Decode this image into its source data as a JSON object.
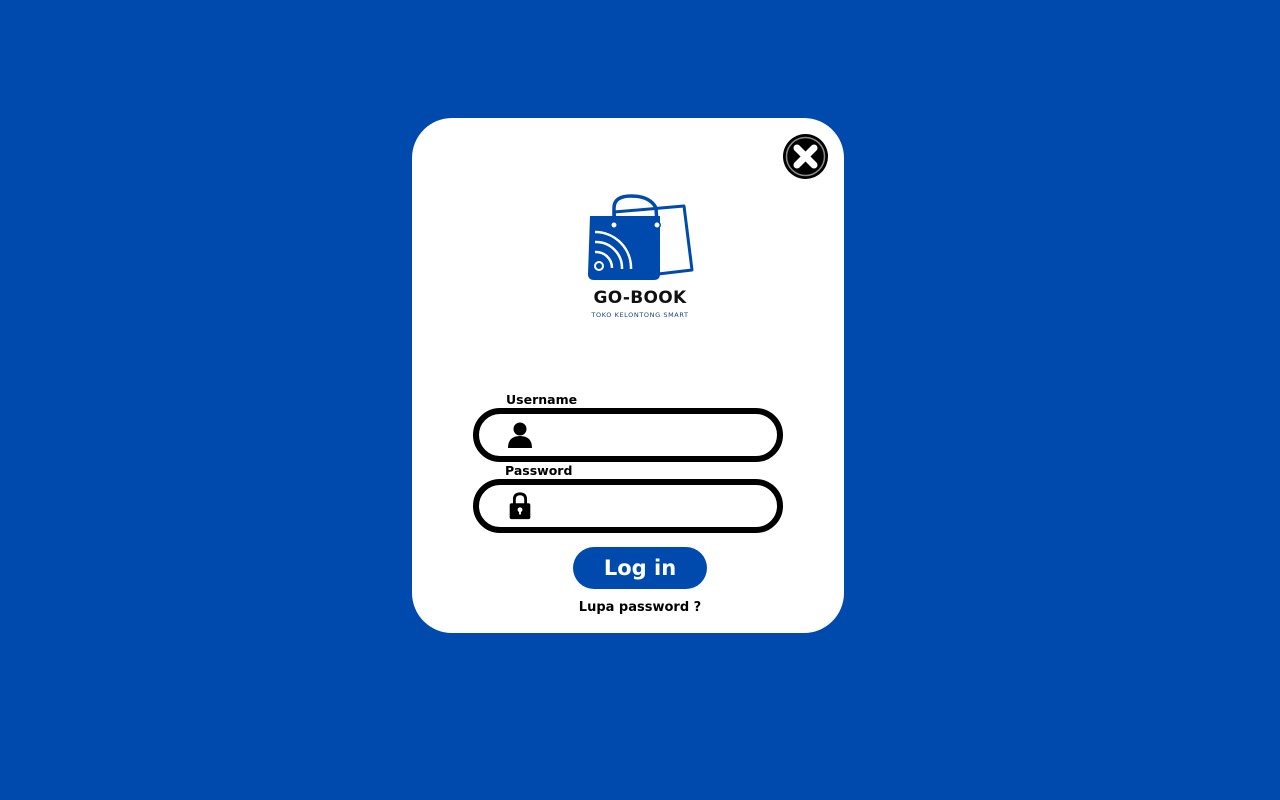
{
  "colors": {
    "background": "#004aad",
    "card": "#ffffff",
    "accent": "#004aad",
    "text": "#000000"
  },
  "close_button": {
    "icon": "close-icon"
  },
  "logo": {
    "brand_name": "GO-BOOK",
    "tagline": "TOKO KELONTONG SMART",
    "icon": "shopping-bag-logo"
  },
  "form": {
    "username": {
      "label": "Username",
      "value": "",
      "placeholder": "",
      "icon": "user-icon"
    },
    "password": {
      "label": "Password",
      "value": "",
      "placeholder": "",
      "icon": "lock-icon"
    },
    "login_label": "Log in",
    "forgot_label": "Lupa password ?"
  }
}
